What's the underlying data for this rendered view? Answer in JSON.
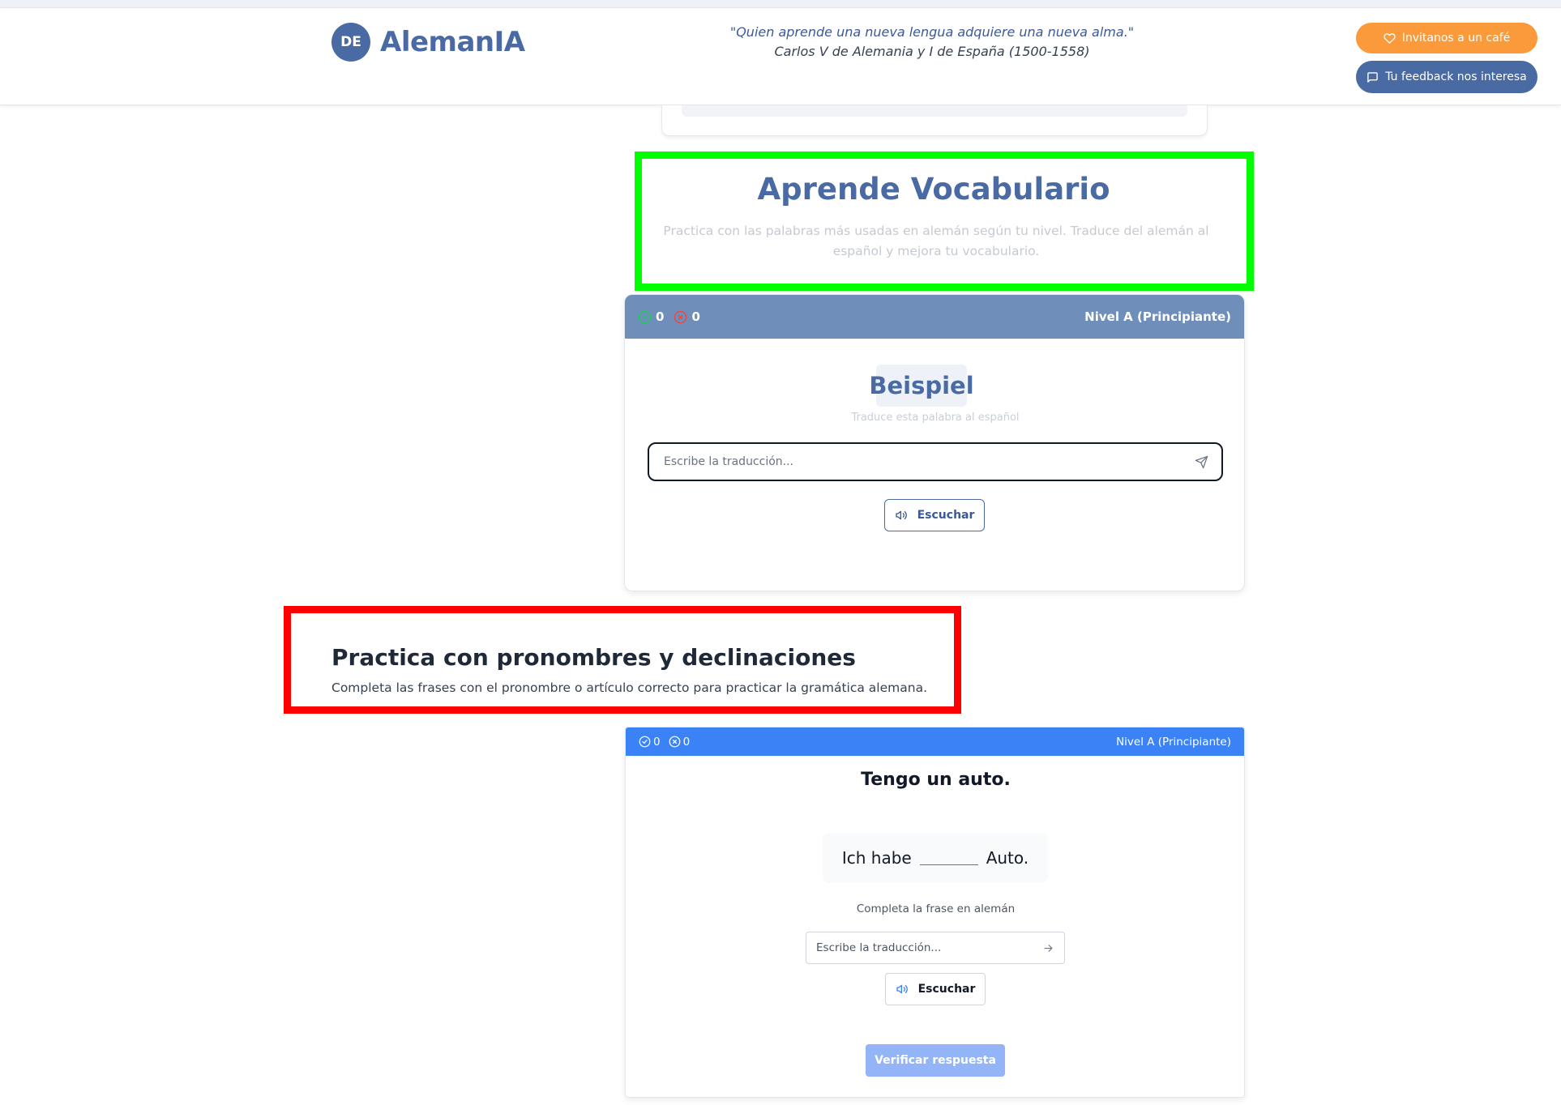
{
  "header": {
    "logo_badge": "DE",
    "logo_text": "AlemanIA",
    "quote_line1": "\"Quien aprende una nueva lengua adquiere una nueva alma.\"",
    "quote_line2": "Carlos V de Alemania y I de España (1500-1558)",
    "coffee_label": "Invitanos a un café",
    "feedback_label": "Tu feedback nos interesa"
  },
  "vocab": {
    "title": "Aprende Vocabulario",
    "subtitle": "Practica con las palabras más usadas en alemán según tu nivel. Traduce del alemán al español y mejora tu vocabulario.",
    "correct_count": "0",
    "wrong_count": "0",
    "level": "Nivel A (Principiante)",
    "word": "Beispiel",
    "hint": "Traduce esta palabra al español",
    "input_placeholder": "Escribe la traducción...",
    "listen_label": "Escuchar"
  },
  "grammar": {
    "title": "Practica con pronombres y declinaciones",
    "subtitle": "Completa las frases con el pronombre o artículo correcto para practicar la gramática alemana.",
    "correct_count": "0",
    "wrong_count": "0",
    "level": "Nivel A (Principiante)",
    "sentence_es": "Tengo un auto.",
    "sentence_de_before": "Ich habe",
    "sentence_de_after": "Auto.",
    "hint": "Completa la frase en alemán",
    "input_placeholder": "Escribe la traducción...",
    "listen_label": "Escuchar",
    "verify_label": "Verificar respuesta"
  },
  "colors": {
    "brand": "#4a6aa3",
    "coffee": "#fa9a3a",
    "grammar_header": "#3b82f6",
    "highlight_green": "#00ff00",
    "highlight_red": "#ff0000"
  }
}
